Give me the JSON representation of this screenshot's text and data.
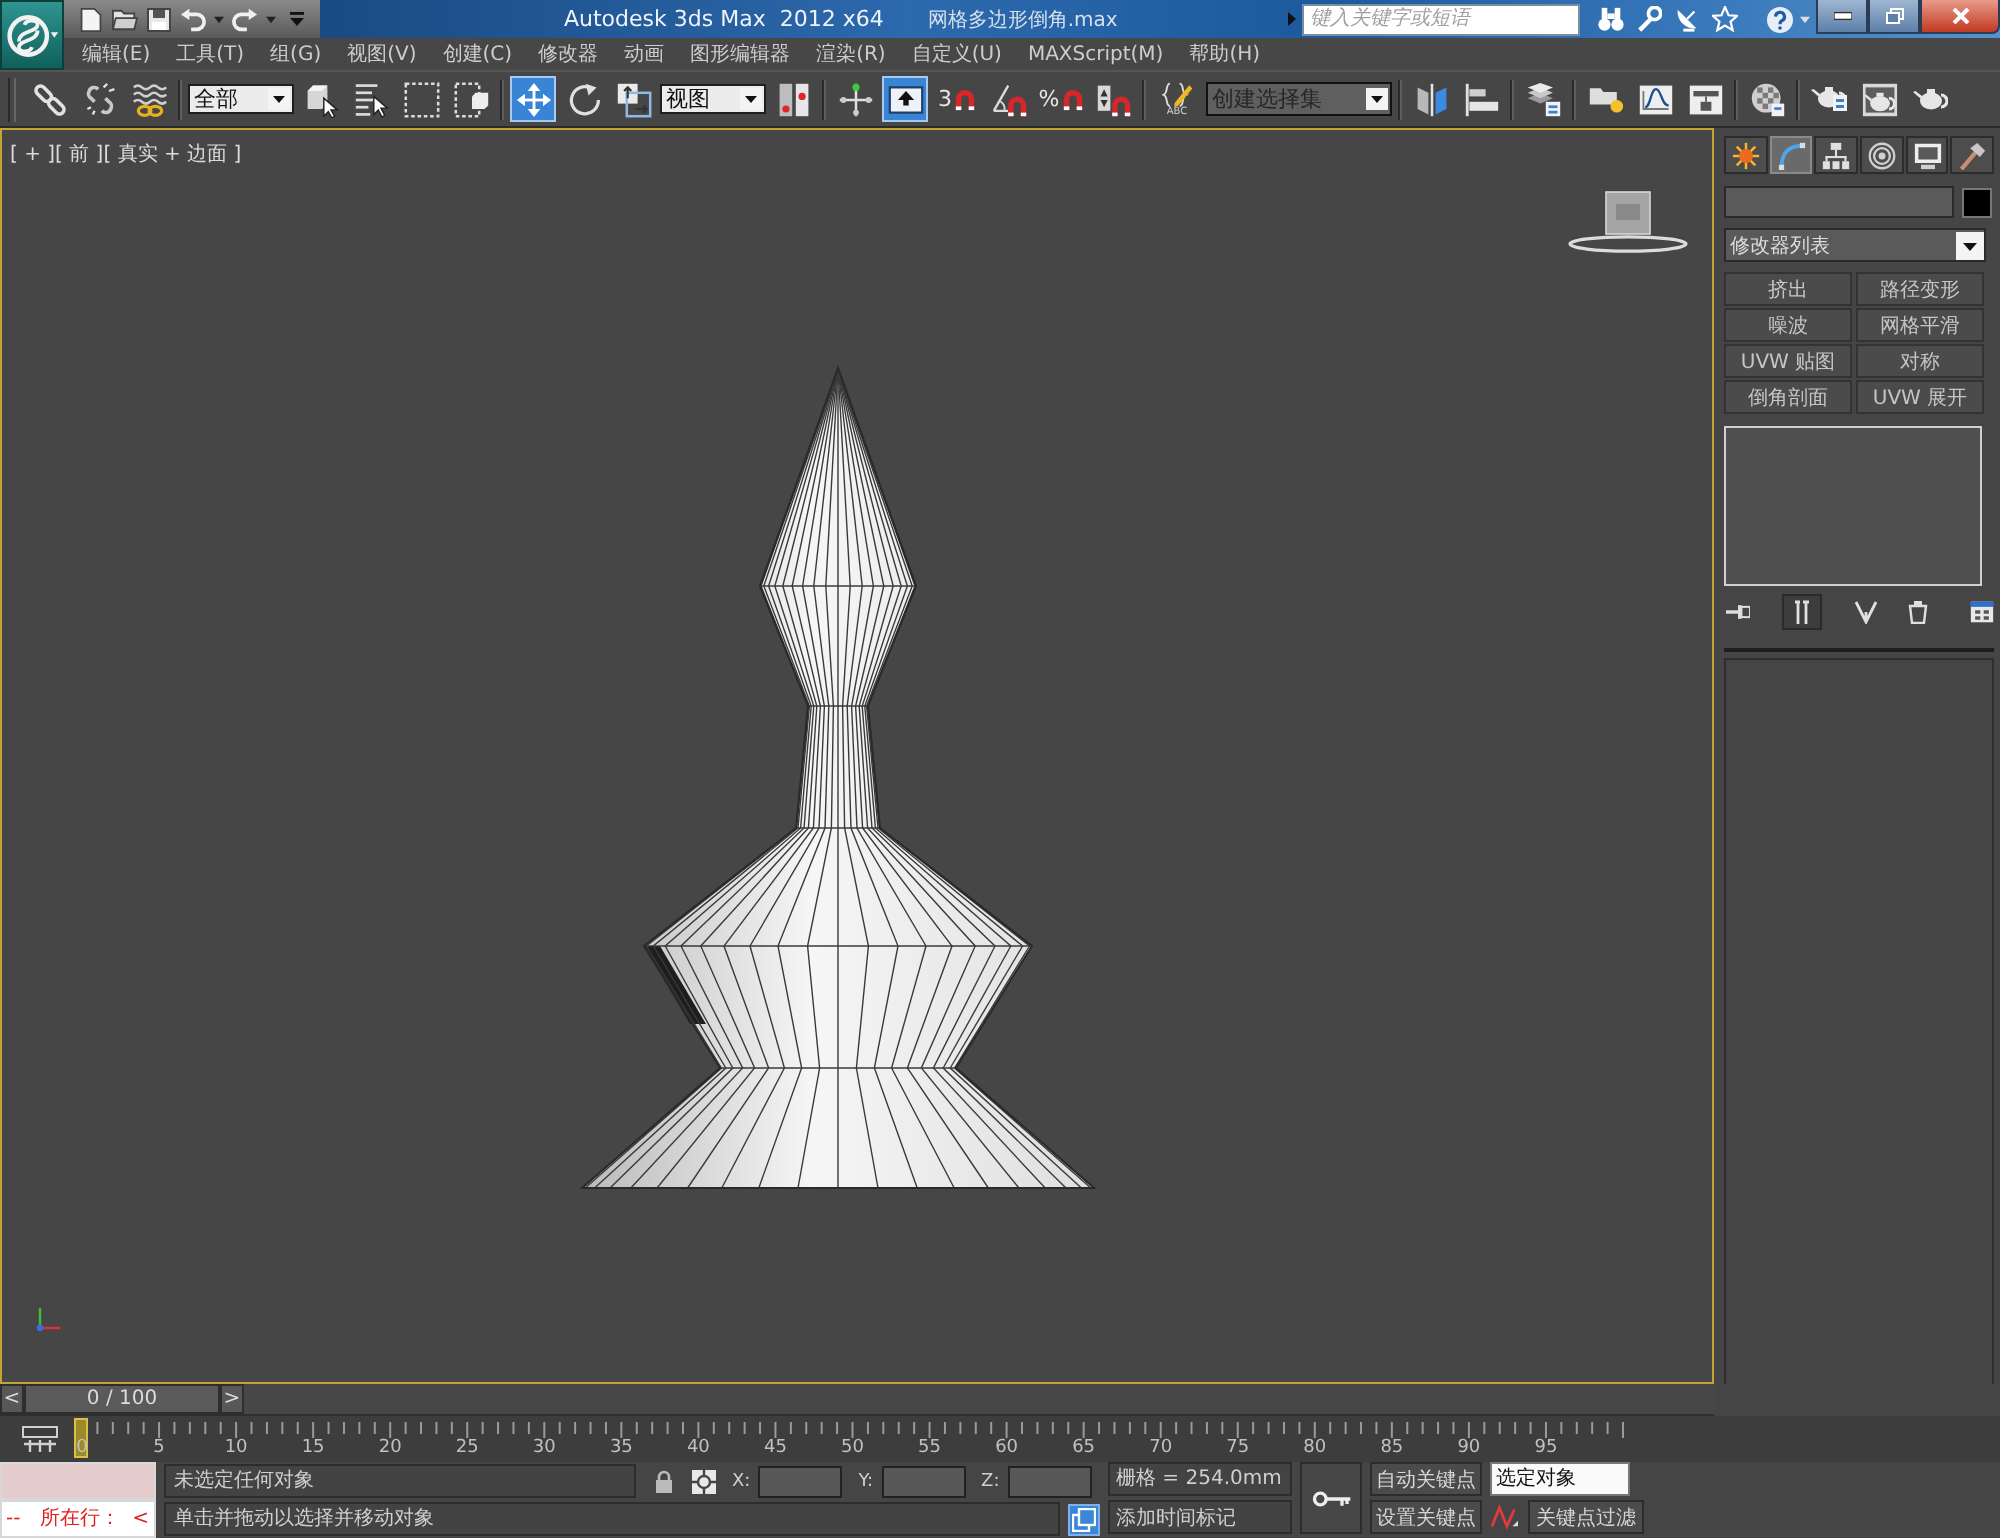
{
  "title_bar": {
    "app_title": "Autodesk 3ds Max  2012 x64",
    "file_name": "网格多边形倒角.max",
    "search": {
      "placeholder": "键入关键字或短语"
    }
  },
  "menu": [
    "编辑(E)",
    "工具(T)",
    "组(G)",
    "视图(V)",
    "创建(C)",
    "修改器",
    "动画",
    "图形编辑器",
    "渲染(R)",
    "自定义(U)",
    "MAXScript(M)",
    "帮助(H)"
  ],
  "main_toolbar": {
    "groups": [
      {
        "items": [
          {
            "kind": "link",
            "selected": false
          },
          {
            "kind": "unlink",
            "selected": false
          },
          {
            "kind": "bind",
            "selected": false
          }
        ]
      },
      {
        "items": [
          {
            "kind": "dropdown",
            "value": "全部"
          },
          {
            "kind": "select",
            "selected": false
          },
          {
            "kind": "select-by-name",
            "selected": false
          },
          {
            "kind": "region",
            "selected": false
          },
          {
            "kind": "crossing",
            "selected": false
          }
        ]
      },
      {
        "items": [
          {
            "kind": "move",
            "selected": true
          },
          {
            "kind": "rotate",
            "selected": false
          },
          {
            "kind": "scale",
            "selected": false
          },
          {
            "kind": "dropdown",
            "value": "视图"
          },
          {
            "kind": "pivot",
            "selected": false
          }
        ]
      },
      {
        "items": [
          {
            "kind": "manipulate",
            "selected": false
          },
          {
            "kind": "shortcut",
            "selected": true
          },
          {
            "kind": "snap",
            "label": "3",
            "selected": false
          },
          {
            "kind": "angle-snap",
            "selected": false
          },
          {
            "kind": "percent-snap",
            "label": "%",
            "selected": false
          },
          {
            "kind": "spinner-snap",
            "selected": false
          }
        ]
      },
      {
        "items": [
          {
            "kind": "named-sets",
            "label": "ABC",
            "selected": false
          },
          {
            "kind": "combo",
            "placeholder": "创建选择集"
          }
        ]
      },
      {
        "items": [
          {
            "kind": "mirror",
            "selected": false
          },
          {
            "kind": "align",
            "selected": false
          }
        ]
      },
      {
        "items": [
          {
            "kind": "layers",
            "selected": false
          }
        ]
      },
      {
        "items": [
          {
            "kind": "ribbon",
            "selected": false
          },
          {
            "kind": "curve-editor",
            "selected": false
          },
          {
            "kind": "schematic",
            "selected": false
          }
        ]
      },
      {
        "items": [
          {
            "kind": "material",
            "selected": false
          }
        ]
      },
      {
        "items": [
          {
            "kind": "render-setup",
            "selected": false
          },
          {
            "kind": "frame-window",
            "selected": false
          },
          {
            "kind": "render",
            "selected": false
          }
        ]
      }
    ]
  },
  "viewport": {
    "label": "[ + ][ 前 ][ 真实 + 边面 ]",
    "active": true
  },
  "command_panel": {
    "tabs": [
      {
        "kind": "create",
        "selected": false
      },
      {
        "kind": "modify",
        "selected": true
      },
      {
        "kind": "hierarchy",
        "selected": false
      },
      {
        "kind": "motion",
        "selected": false
      },
      {
        "kind": "display",
        "selected": false
      },
      {
        "kind": "utilities",
        "selected": false
      }
    ],
    "modifier_list": "修改器列表",
    "modifier_buttons": [
      "挤出",
      "路径变形",
      "噪波",
      "网格平滑",
      "UVW 贴图",
      "对称",
      "倒角剖面",
      "UVW 展开"
    ],
    "stack_tools": [
      {
        "kind": "pin",
        "selected": false
      },
      {
        "kind": "end-result",
        "selected": true
      },
      {
        "kind": "make-unique",
        "selected": false
      },
      {
        "kind": "remove",
        "selected": false
      },
      {
        "kind": "configure",
        "selected": false
      }
    ]
  },
  "time_slider": {
    "prev": "<",
    "position": "0 / 100",
    "next": ">",
    "level": 0
  },
  "track_bar": {
    "labels": [
      "0",
      "5",
      "10",
      "15",
      "20",
      "25",
      "30",
      "35",
      "40",
      "45",
      "50",
      "55",
      "60",
      "65",
      "70",
      "75",
      "80",
      "85",
      "90",
      "95"
    ]
  },
  "status_bar": {
    "listener_output": "--   所在行：  <",
    "selection": "未选定任何对象",
    "prompt": "单击并拖动以选择并移动对象",
    "coords": [
      "X:",
      "Y:",
      "Z:"
    ],
    "grid": "栅格 = 254.0mm",
    "time_tag": "添加时间标记",
    "auto_key": "自动关键点",
    "key_mode": "选定对象",
    "set_key": "设置关键点",
    "key_filters": "关键点过滤"
  }
}
